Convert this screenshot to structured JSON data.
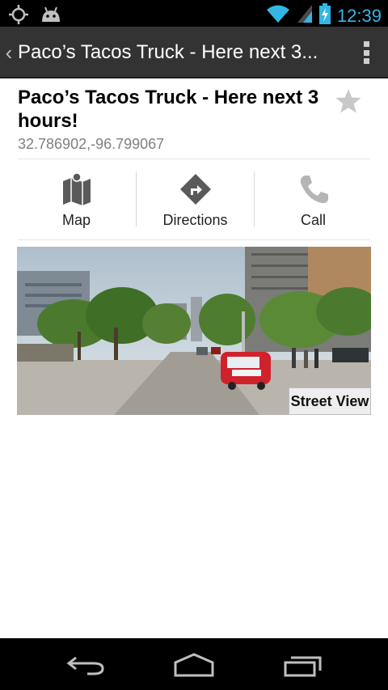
{
  "status_bar": {
    "time": "12:39",
    "icons": [
      "gps-icon",
      "android-icon",
      "wifi-icon",
      "signal-icon",
      "battery-charging-icon"
    ]
  },
  "action_bar": {
    "title": "Paco’s Tacos Truck - Here next 3...",
    "back_icon": "chevron-left-icon",
    "overflow_icon": "overflow-menu-icon"
  },
  "place": {
    "title": "Paco’s Tacos Truck - Here next 3 hours!",
    "coordinates": "32.786902,-96.799067",
    "star_icon": "star-icon"
  },
  "actions": [
    {
      "label": "Map",
      "icon": "map-icon"
    },
    {
      "label": "Directions",
      "icon": "directions-icon"
    },
    {
      "label": "Call",
      "icon": "phone-icon"
    }
  ],
  "street_view": {
    "button_label": "Street View"
  },
  "nav_bar": {
    "icons": [
      "back-icon",
      "home-icon",
      "recents-icon"
    ]
  },
  "colors": {
    "accent": "#33b5e5",
    "action_bar": "#333333",
    "icon_gray": "#5a5a5a"
  }
}
